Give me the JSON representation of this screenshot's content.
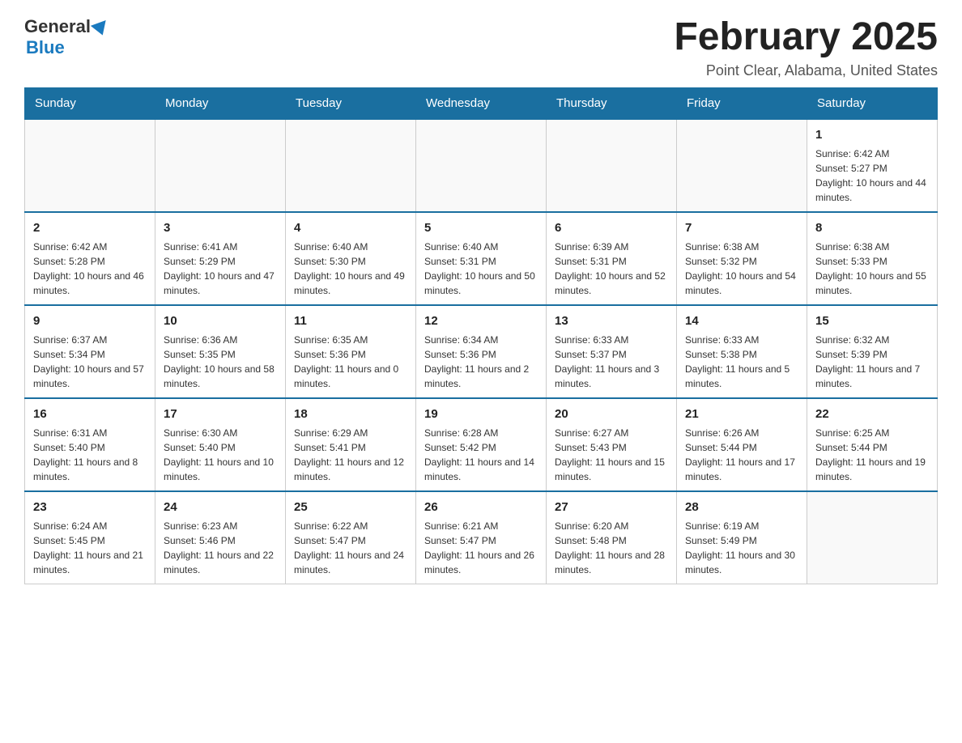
{
  "logo": {
    "general": "General",
    "blue": "Blue"
  },
  "header": {
    "title": "February 2025",
    "subtitle": "Point Clear, Alabama, United States"
  },
  "days_of_week": [
    "Sunday",
    "Monday",
    "Tuesday",
    "Wednesday",
    "Thursday",
    "Friday",
    "Saturday"
  ],
  "weeks": [
    [
      {
        "day": "",
        "info": ""
      },
      {
        "day": "",
        "info": ""
      },
      {
        "day": "",
        "info": ""
      },
      {
        "day": "",
        "info": ""
      },
      {
        "day": "",
        "info": ""
      },
      {
        "day": "",
        "info": ""
      },
      {
        "day": "1",
        "info": "Sunrise: 6:42 AM\nSunset: 5:27 PM\nDaylight: 10 hours and 44 minutes."
      }
    ],
    [
      {
        "day": "2",
        "info": "Sunrise: 6:42 AM\nSunset: 5:28 PM\nDaylight: 10 hours and 46 minutes."
      },
      {
        "day": "3",
        "info": "Sunrise: 6:41 AM\nSunset: 5:29 PM\nDaylight: 10 hours and 47 minutes."
      },
      {
        "day": "4",
        "info": "Sunrise: 6:40 AM\nSunset: 5:30 PM\nDaylight: 10 hours and 49 minutes."
      },
      {
        "day": "5",
        "info": "Sunrise: 6:40 AM\nSunset: 5:31 PM\nDaylight: 10 hours and 50 minutes."
      },
      {
        "day": "6",
        "info": "Sunrise: 6:39 AM\nSunset: 5:31 PM\nDaylight: 10 hours and 52 minutes."
      },
      {
        "day": "7",
        "info": "Sunrise: 6:38 AM\nSunset: 5:32 PM\nDaylight: 10 hours and 54 minutes."
      },
      {
        "day": "8",
        "info": "Sunrise: 6:38 AM\nSunset: 5:33 PM\nDaylight: 10 hours and 55 minutes."
      }
    ],
    [
      {
        "day": "9",
        "info": "Sunrise: 6:37 AM\nSunset: 5:34 PM\nDaylight: 10 hours and 57 minutes."
      },
      {
        "day": "10",
        "info": "Sunrise: 6:36 AM\nSunset: 5:35 PM\nDaylight: 10 hours and 58 minutes."
      },
      {
        "day": "11",
        "info": "Sunrise: 6:35 AM\nSunset: 5:36 PM\nDaylight: 11 hours and 0 minutes."
      },
      {
        "day": "12",
        "info": "Sunrise: 6:34 AM\nSunset: 5:36 PM\nDaylight: 11 hours and 2 minutes."
      },
      {
        "day": "13",
        "info": "Sunrise: 6:33 AM\nSunset: 5:37 PM\nDaylight: 11 hours and 3 minutes."
      },
      {
        "day": "14",
        "info": "Sunrise: 6:33 AM\nSunset: 5:38 PM\nDaylight: 11 hours and 5 minutes."
      },
      {
        "day": "15",
        "info": "Sunrise: 6:32 AM\nSunset: 5:39 PM\nDaylight: 11 hours and 7 minutes."
      }
    ],
    [
      {
        "day": "16",
        "info": "Sunrise: 6:31 AM\nSunset: 5:40 PM\nDaylight: 11 hours and 8 minutes."
      },
      {
        "day": "17",
        "info": "Sunrise: 6:30 AM\nSunset: 5:40 PM\nDaylight: 11 hours and 10 minutes."
      },
      {
        "day": "18",
        "info": "Sunrise: 6:29 AM\nSunset: 5:41 PM\nDaylight: 11 hours and 12 minutes."
      },
      {
        "day": "19",
        "info": "Sunrise: 6:28 AM\nSunset: 5:42 PM\nDaylight: 11 hours and 14 minutes."
      },
      {
        "day": "20",
        "info": "Sunrise: 6:27 AM\nSunset: 5:43 PM\nDaylight: 11 hours and 15 minutes."
      },
      {
        "day": "21",
        "info": "Sunrise: 6:26 AM\nSunset: 5:44 PM\nDaylight: 11 hours and 17 minutes."
      },
      {
        "day": "22",
        "info": "Sunrise: 6:25 AM\nSunset: 5:44 PM\nDaylight: 11 hours and 19 minutes."
      }
    ],
    [
      {
        "day": "23",
        "info": "Sunrise: 6:24 AM\nSunset: 5:45 PM\nDaylight: 11 hours and 21 minutes."
      },
      {
        "day": "24",
        "info": "Sunrise: 6:23 AM\nSunset: 5:46 PM\nDaylight: 11 hours and 22 minutes."
      },
      {
        "day": "25",
        "info": "Sunrise: 6:22 AM\nSunset: 5:47 PM\nDaylight: 11 hours and 24 minutes."
      },
      {
        "day": "26",
        "info": "Sunrise: 6:21 AM\nSunset: 5:47 PM\nDaylight: 11 hours and 26 minutes."
      },
      {
        "day": "27",
        "info": "Sunrise: 6:20 AM\nSunset: 5:48 PM\nDaylight: 11 hours and 28 minutes."
      },
      {
        "day": "28",
        "info": "Sunrise: 6:19 AM\nSunset: 5:49 PM\nDaylight: 11 hours and 30 minutes."
      },
      {
        "day": "",
        "info": ""
      }
    ]
  ]
}
